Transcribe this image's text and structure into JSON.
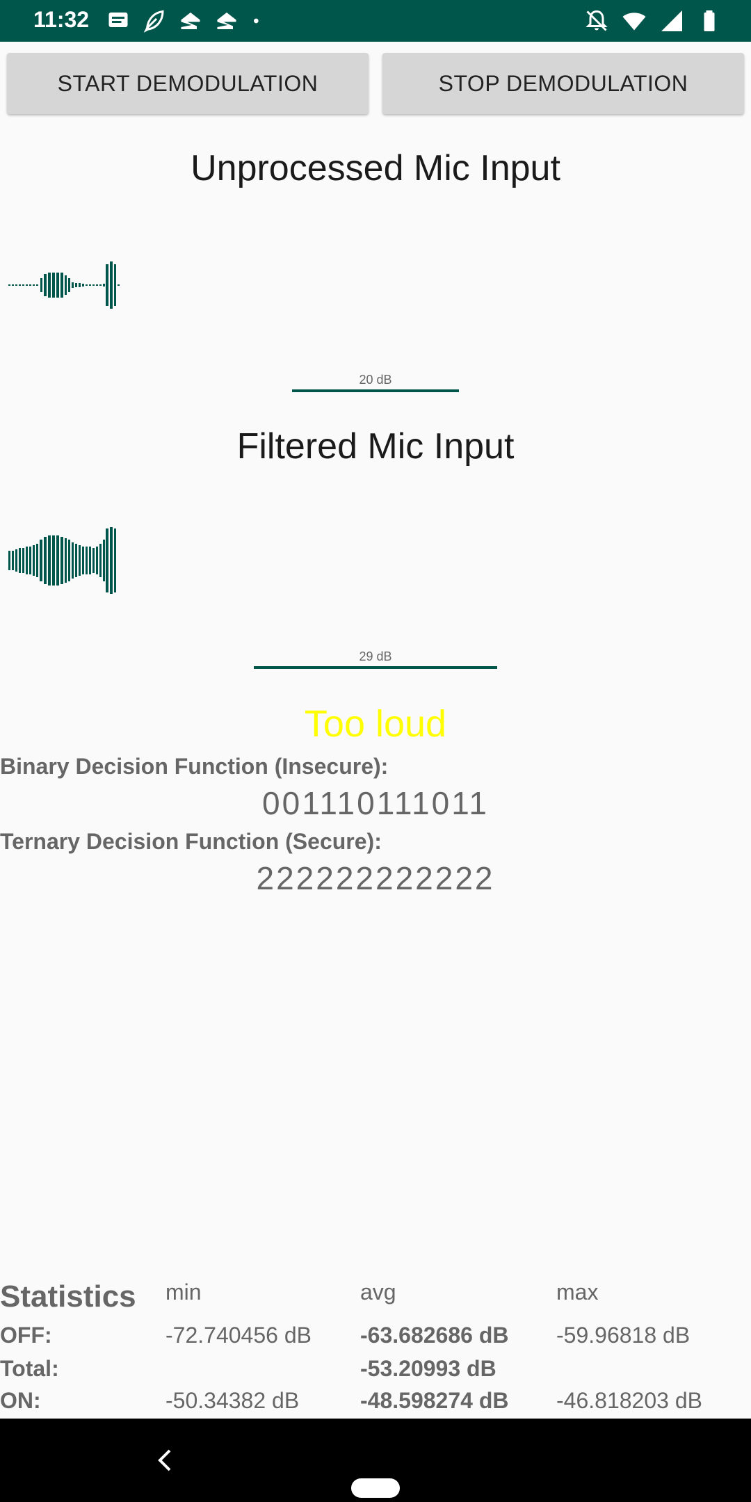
{
  "status_bar": {
    "time": "11:32",
    "left_icons": [
      "message-icon",
      "feather-icon",
      "zillow-icon",
      "zillow-icon",
      "dot-icon"
    ],
    "right_icons": [
      "bell-off-icon",
      "wifi-icon",
      "signal-icon",
      "battery-icon"
    ]
  },
  "buttons": {
    "start_label": "START DEMODULATION",
    "stop_label": "STOP DEMODULATION"
  },
  "unprocessed": {
    "title": "Unprocessed Mic Input",
    "level_label": "20 dB"
  },
  "filtered": {
    "title": "Filtered Mic Input",
    "level_label": "29 dB"
  },
  "warning": "Too loud",
  "decision": {
    "binary_label": "Binary Decision Function (Insecure):",
    "binary_value": "001110111011",
    "ternary_label": "Ternary Decision Function (Secure):",
    "ternary_value": "222222222222"
  },
  "statistics": {
    "title": "Statistics",
    "columns": {
      "min": "min",
      "avg": "avg",
      "max": "max"
    },
    "rows": {
      "off": {
        "label": "OFF:",
        "min": "-72.740456 dB",
        "avg": "-63.682686 dB",
        "max": "-59.96818 dB"
      },
      "total": {
        "label": "Total:",
        "avg": "-53.20993 dB"
      },
      "on": {
        "label": "ON:",
        "min": "-50.34382 dB",
        "avg": "-48.598274 dB",
        "max": "-46.818203 dB"
      }
    }
  },
  "colors": {
    "accent": "#00564a",
    "warning": "#ffff00",
    "stats_text": "#666666"
  }
}
